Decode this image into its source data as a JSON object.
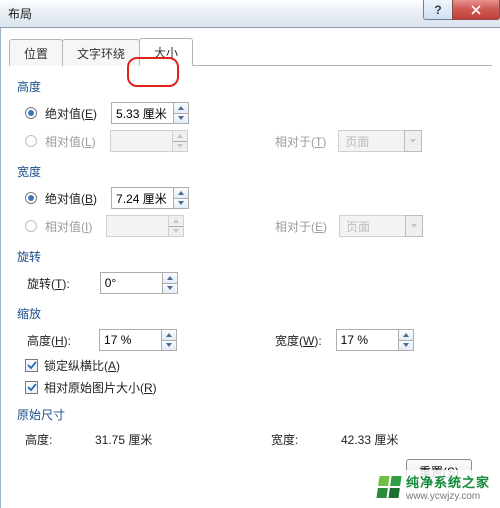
{
  "window": {
    "title": "布局",
    "help_glyph": "?",
    "close_label": "Close"
  },
  "tabs": {
    "position": "位置",
    "wrap": "文字环绕",
    "size": "大小"
  },
  "height": {
    "label": "高度",
    "abs": {
      "label_pre": "绝对值(",
      "key": "E",
      "label_post": ")",
      "value": "5.33 厘米"
    },
    "rel": {
      "label_pre": "相对值(",
      "key": "L",
      "label_post": ")"
    },
    "rel_to": {
      "label_pre": "相对于(",
      "key": "T",
      "label_post": ")",
      "value": "页面"
    }
  },
  "width": {
    "label": "宽度",
    "abs": {
      "label_pre": "绝对值(",
      "key": "B",
      "label_post": ")",
      "value": "7.24 厘米"
    },
    "rel": {
      "label_pre": "相对值(",
      "key": "I",
      "label_post": ")"
    },
    "rel_to": {
      "label_pre": "相对于(",
      "key": "E",
      "label_post": ")",
      "value": "页面"
    }
  },
  "rotate": {
    "label": "旋转",
    "field": {
      "label_pre": "旋转(",
      "key": "T",
      "label_post": "):",
      "value": "0°"
    }
  },
  "scale": {
    "label": "缩放",
    "h": {
      "label_pre": "高度(",
      "key": "H",
      "label_post": "):",
      "value": "17 %"
    },
    "w": {
      "label_pre": "宽度(",
      "key": "W",
      "label_post": "):",
      "value": "17 %"
    },
    "lock": {
      "label_pre": "锁定纵横比(",
      "key": "A",
      "label_post": ")"
    },
    "relpic": {
      "label_pre": "相对原始图片大小(",
      "key": "R",
      "label_post": ")"
    }
  },
  "original": {
    "label": "原始尺寸",
    "h_label": "高度:",
    "h_value": "31.75 厘米",
    "w_label": "宽度:",
    "w_value": "42.33 厘米"
  },
  "reset": {
    "label_pre": "重置(",
    "key": "S",
    "label_post": ")"
  },
  "watermark": {
    "line1": "纯净系统之家",
    "line2": "www.ycwjzy.com"
  }
}
